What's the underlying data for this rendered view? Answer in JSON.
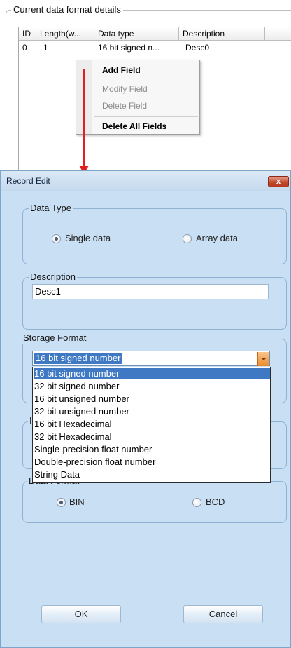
{
  "top_panel": {
    "group_title": "Current data format details",
    "columns": [
      "ID",
      "Length(w...",
      "Data type",
      "Description"
    ],
    "rows": [
      {
        "id": "0",
        "length": "1",
        "data_type": "16 bit signed n...",
        "description": "Desc0"
      }
    ]
  },
  "context_menu": {
    "items": [
      {
        "label": "Add Field",
        "enabled": true
      },
      {
        "label": "Modify Field",
        "enabled": false
      },
      {
        "label": "Delete Field",
        "enabled": false
      },
      {
        "label": "Delete All Fields",
        "enabled": true
      }
    ]
  },
  "dialog": {
    "title": "Record Edit",
    "close_label": "x",
    "data_type": {
      "legend": "Data Type",
      "options": [
        {
          "label": "Single data",
          "checked": true
        },
        {
          "label": "Array data",
          "checked": false
        }
      ]
    },
    "description": {
      "legend": "Description",
      "value": "Desc1"
    },
    "storage_format": {
      "legend": "Storage Format",
      "selected": "16 bit signed number",
      "options": [
        "16 bit signed number",
        "32 bit signed number",
        "16 bit unsigned number",
        "32 bit unsigned number",
        "16 bit Hexadecimal",
        "32 bit Hexadecimal",
        "Single-precision float number",
        "Double-precision float number",
        "String Data"
      ]
    },
    "hidden_group_fragment": "I",
    "data_format": {
      "legend": "Data Format",
      "options": [
        {
          "label": "BIN",
          "checked": true
        },
        {
          "label": "BCD",
          "checked": false
        }
      ]
    },
    "ok_label": "OK",
    "cancel_label": "Cancel"
  },
  "colors": {
    "dialog_bg": "#c9dff3",
    "selection": "#3f79c4",
    "arrow": "#e02020",
    "close_button": "#c44a2e"
  }
}
